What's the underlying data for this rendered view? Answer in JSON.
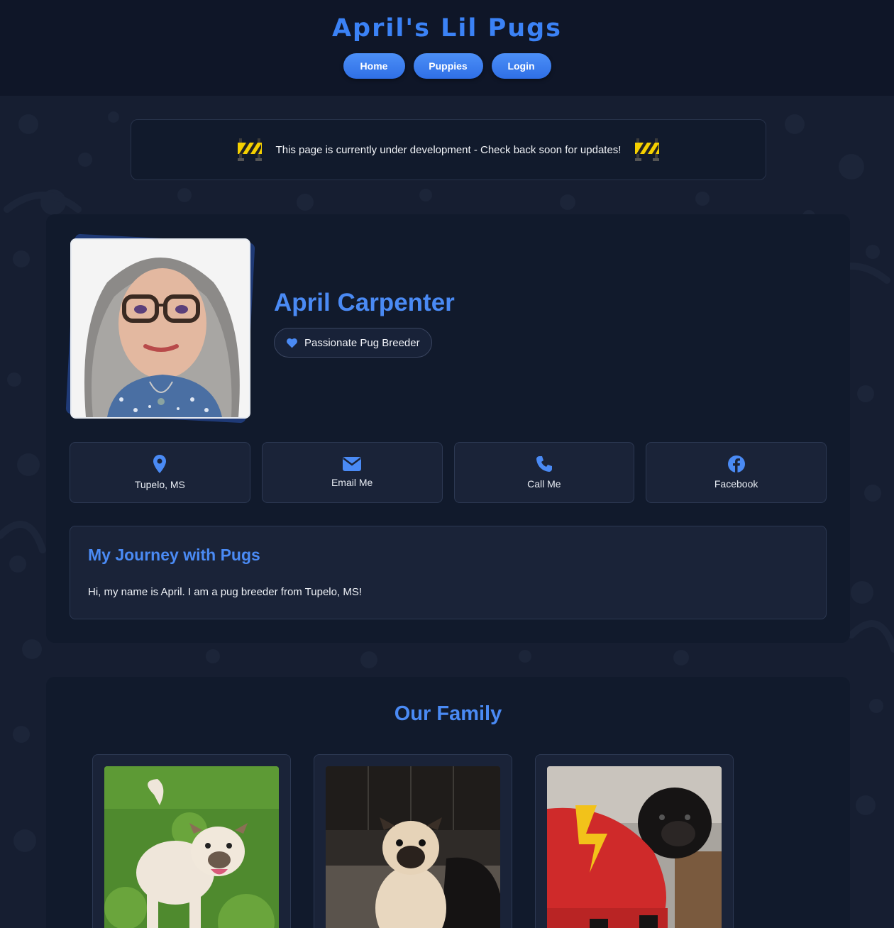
{
  "site": {
    "title": "April's Lil Pugs"
  },
  "nav": {
    "items": [
      {
        "label": "Home"
      },
      {
        "label": "Puppies"
      },
      {
        "label": "Login"
      }
    ]
  },
  "notice": {
    "text": "This page is currently under development - Check back soon for updates!",
    "icon": "construction-barrier-icon"
  },
  "profile": {
    "name": "April Carpenter",
    "badge": "Passionate Pug Breeder",
    "badge_icon": "heart-icon",
    "photo_alt": "April Carpenter portrait"
  },
  "contacts": [
    {
      "label": "Tupelo, MS",
      "icon": "location-pin-icon"
    },
    {
      "label": "Email Me",
      "icon": "envelope-icon"
    },
    {
      "label": "Call Me",
      "icon": "phone-icon"
    },
    {
      "label": "Facebook",
      "icon": "facebook-icon"
    }
  ],
  "journey": {
    "title": "My Journey with Pugs",
    "text": "Hi, my name is April. I am a pug breeder from Tupelo, MS!"
  },
  "family": {
    "title": "Our Family",
    "pugs": [
      {
        "photo": "fawn pug standing on grass"
      },
      {
        "photo": "fawn pug sitting indoors"
      },
      {
        "photo": "black pug in red sweater"
      }
    ]
  },
  "colors": {
    "accent": "#3b82f6",
    "header_bg": "#0f1628",
    "card_bg": "#111a2c",
    "page_bg": "#161e31"
  }
}
